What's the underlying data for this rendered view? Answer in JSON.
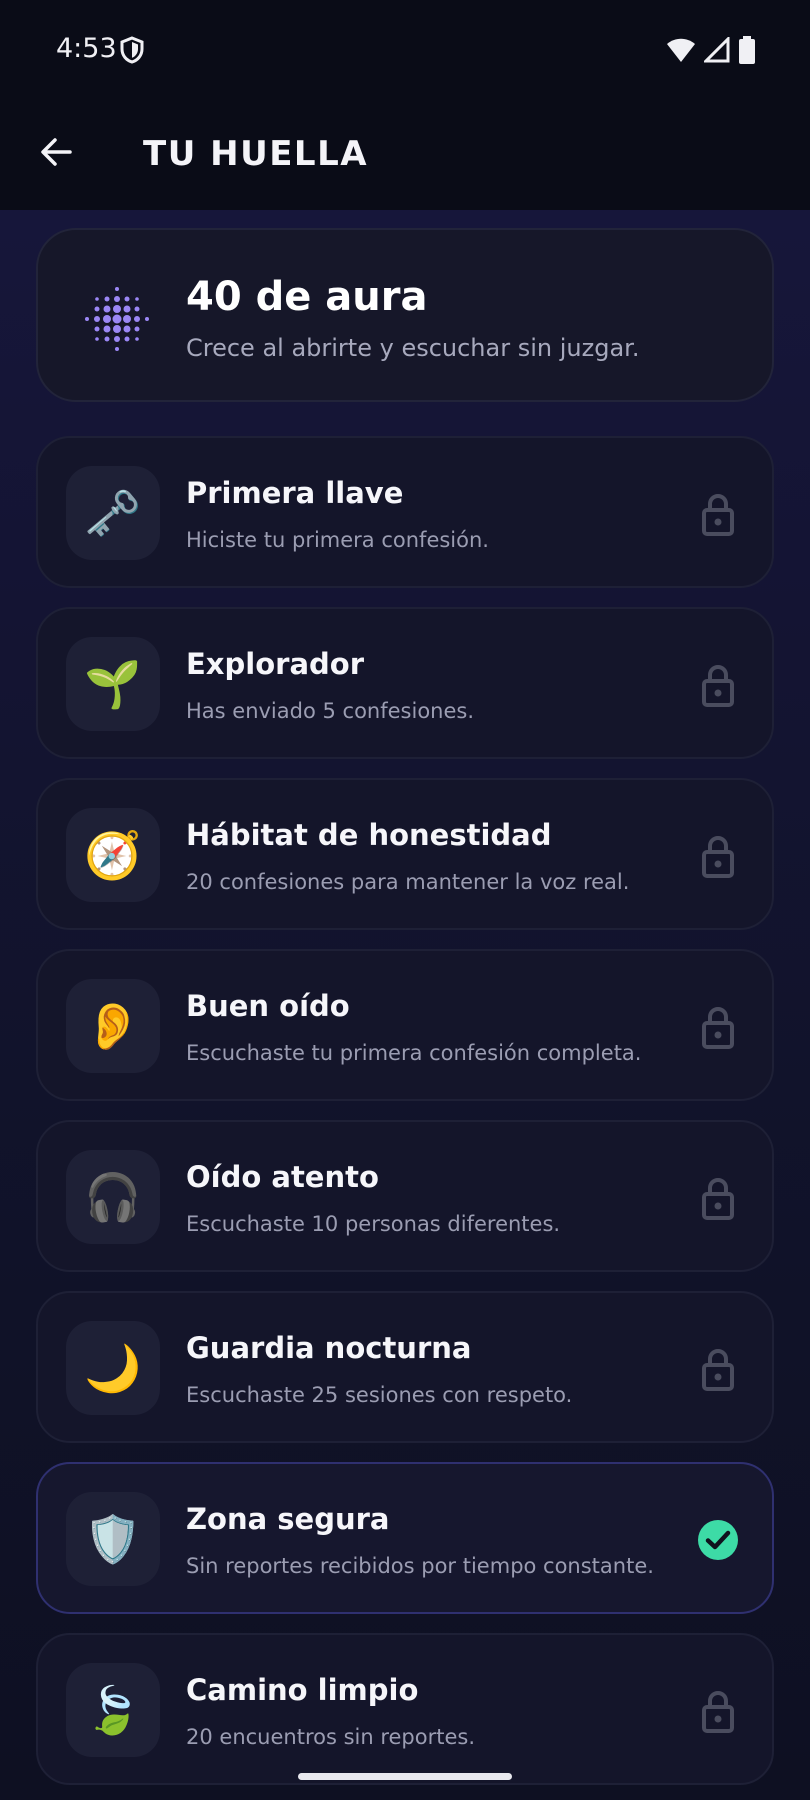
{
  "status_bar": {
    "time": "4:53",
    "icons": [
      "shield-icon",
      "wifi-icon",
      "signal-icon",
      "battery-icon"
    ]
  },
  "app_bar": {
    "back_icon": "arrow-left-icon",
    "title": "TU HUELLA"
  },
  "aura": {
    "icon": "sparkle-dots-icon",
    "title": "40 de aura",
    "subtitle": "Crece al abrirte y escuchar sin juzgar."
  },
  "achievements": [
    {
      "icon": "🗝️",
      "icon_name": "key-icon",
      "title": "Primera llave",
      "description": "Hiciste tu primera confesión.",
      "unlocked": false
    },
    {
      "icon": "🌱",
      "icon_name": "seedling-icon",
      "title": "Explorador",
      "description": "Has enviado 5 confesiones.",
      "unlocked": false
    },
    {
      "icon": "🧭",
      "icon_name": "compass-icon",
      "title": "Hábitat de honestidad",
      "description": "20 confesiones para mantener la voz real.",
      "unlocked": false
    },
    {
      "icon": "👂",
      "icon_name": "ear-icon",
      "title": "Buen oído",
      "description": "Escuchaste tu primera confesión completa.",
      "unlocked": false
    },
    {
      "icon": "🎧",
      "icon_name": "headphones-icon",
      "title": "Oído atento",
      "description": "Escuchaste 10 personas diferentes.",
      "unlocked": false
    },
    {
      "icon": "🌙",
      "icon_name": "moon-icon",
      "title": "Guardia nocturna",
      "description": "Escuchaste 25 sesiones con respeto.",
      "unlocked": false
    },
    {
      "icon": "🛡️",
      "icon_name": "shield-icon",
      "title": "Zona segura",
      "description": "Sin reportes recibidos por tiempo constante.",
      "unlocked": true
    },
    {
      "icon": "🍃",
      "icon_name": "leaf-icon",
      "title": "Camino limpio",
      "description": "20 encuentros sin reportes.",
      "unlocked": false
    }
  ],
  "colors": {
    "background": "#0a0c17",
    "card": "#14152a",
    "accent_purple": "#9b87f5",
    "check_green": "#3ddba6",
    "lock_gray": "#4a4c5e"
  }
}
